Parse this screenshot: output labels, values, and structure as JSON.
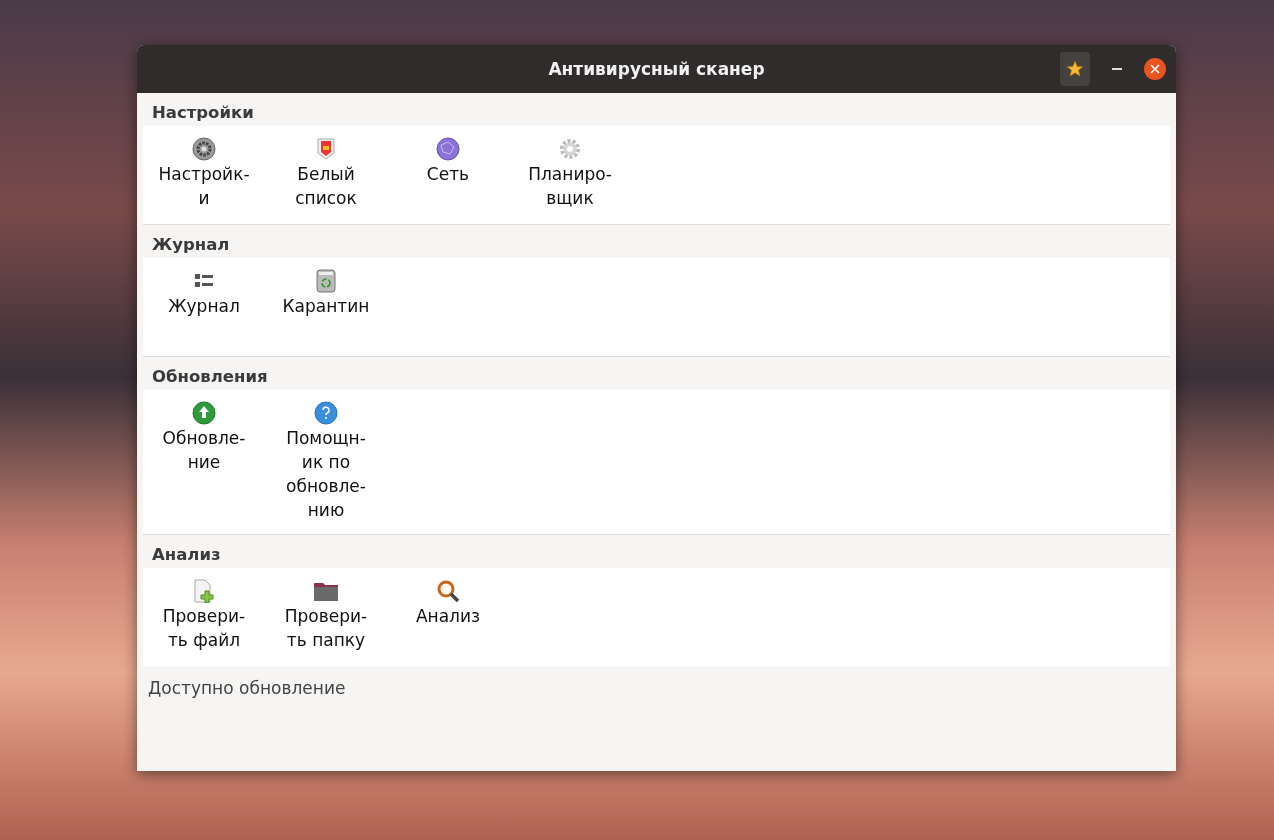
{
  "window": {
    "title": "Антивирусный сканер"
  },
  "sections": [
    {
      "title": "Настройки",
      "items": [
        {
          "label": [
            "Настройк-",
            "и"
          ]
        },
        {
          "label": [
            "Белый",
            "список"
          ]
        },
        {
          "label": [
            "Сеть"
          ]
        },
        {
          "label": [
            "Планиро-",
            "вщик"
          ]
        }
      ]
    },
    {
      "title": "Журнал",
      "items": [
        {
          "label": [
            "Журнал"
          ]
        },
        {
          "label": [
            "Карантин"
          ]
        }
      ]
    },
    {
      "title": "Обновления",
      "items": [
        {
          "label": [
            "Обновле-",
            "ние"
          ]
        },
        {
          "label": [
            "Помощн-",
            "ик по",
            "обновле-",
            "нию"
          ]
        }
      ]
    },
    {
      "title": "Анализ",
      "items": [
        {
          "label": [
            "Провери-",
            "ть файл"
          ]
        },
        {
          "label": [
            "Провери-",
            "ть папку"
          ]
        },
        {
          "label": [
            "Анализ"
          ]
        }
      ]
    }
  ],
  "status_bar": "Доступно обновление"
}
